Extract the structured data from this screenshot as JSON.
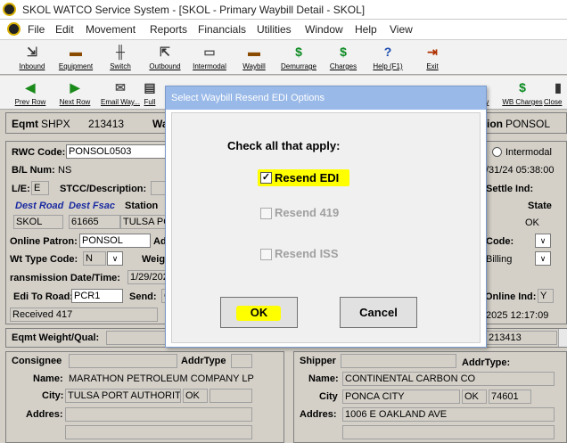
{
  "window": {
    "title": "SKOL WATCO Service System - [SKOL - Primary Waybill Detail - SKOL]"
  },
  "menu": [
    "File",
    "Edit",
    "Movement",
    "Reports",
    "Financials",
    "Utilities",
    "Window",
    "Help",
    "View"
  ],
  "toolbar1": [
    {
      "label": "Inbound",
      "icon": "inbound-icon"
    },
    {
      "label": "Equipment",
      "icon": "equipment-icon"
    },
    {
      "label": "Switch",
      "icon": "switch-icon"
    },
    {
      "label": "Outbound",
      "icon": "outbound-icon"
    },
    {
      "label": "Intermodal",
      "icon": "intermodal-icon"
    },
    {
      "label": "Waybill",
      "icon": "waybill-icon"
    },
    {
      "label": "Demurrage",
      "icon": "demurrage-icon"
    },
    {
      "label": "Charges",
      "icon": "charges-icon"
    },
    {
      "label": "Help (F1)",
      "icon": "help-icon"
    },
    {
      "label": "Exit",
      "icon": "exit-icon"
    }
  ],
  "toolbar2": [
    {
      "label": "Prev Row",
      "icon": "prev-row-icon"
    },
    {
      "label": "Next Row",
      "icon": "next-row-icon"
    },
    {
      "label": "Email Way...",
      "icon": "email-icon"
    },
    {
      "label": "Full",
      "icon": "full-icon"
    },
    {
      "label": "ry",
      "icon": "history-icon"
    },
    {
      "label": "WB Charges",
      "icon": "wb-charges-icon"
    },
    {
      "label": "Close",
      "icon": "close-icon"
    }
  ],
  "header": {
    "eqmt_label": "Eqmt",
    "eqmt_init": "SHPX",
    "eqmt_num": "213413",
    "wa_label": "Wa",
    "station_label": "ion",
    "station_value": "PONSOL"
  },
  "form": {
    "rwc_label": "RWC Code:",
    "rwc_value": "PONSOL0503",
    "bl_label": "B/L Num:",
    "bl_value": "NS",
    "le_label": "L/E:",
    "le_value": "E",
    "stcc_label": "STCC/Description:",
    "dest_road_label": "Dest Road",
    "dest_fsac_label": "Dest Fsac",
    "station_label": "Station",
    "dest_road_value": "SKOL",
    "dest_fsac_value": "61665",
    "station_value": "TULSA PO",
    "online_patron_label": "Online Patron:",
    "online_patron_value": "PONSOL",
    "ad_label": "Ad",
    "wt_type_label": "Wt Type Code:",
    "wt_type_value": "N",
    "weig_label": "Weig",
    "trans_label": "ransmission Date/Time:",
    "trans_value": "1/29/202",
    "edi_road_label": "Edi To Road:",
    "edi_road_value": "PCR1",
    "send_label": "Send:",
    "send_value": "C",
    "received_value": "Received 417",
    "intermodal_label": "Intermodal",
    "date_value": "/31/24 05:38:00",
    "settle_label": "Settle Ind:",
    "state_label": "State",
    "state_value": "OK",
    "code_label": "Code:",
    "billing_value": "Billing",
    "online_ind_label": "Online Ind:",
    "online_ind_value": "Y",
    "time_value": "2025 12:17:09"
  },
  "weight": {
    "label": "Eqmt Weight/Qual:",
    "right_value": "213413"
  },
  "consignee": {
    "title": "Consignee",
    "addrtype_label": "AddrType",
    "name_label": "Name:",
    "name_value": "MARATHON PETROLEUM COMPANY LP",
    "city_label": "City:",
    "city_value": "TULSA PORT AUTHORIT",
    "state_value": "OK",
    "address_label": "Addres:"
  },
  "shipper": {
    "title": "Shipper",
    "addrtype_label": "AddrType:",
    "name_label": "Name:",
    "name_value": "CONTINENTAL CARBON CO",
    "city_label": "City",
    "city_value": "PONCA CITY",
    "state_value": "OK",
    "zip_value": "74601",
    "address_label": "Addres:",
    "address_value": "1006 E OAKLAND AVE"
  },
  "dialog": {
    "title": "Select Waybill Resend EDI Options",
    "prompt": "Check all that apply:",
    "options": [
      {
        "label": "Resend EDI",
        "checked": true,
        "enabled": true
      },
      {
        "label": "Resend 419",
        "checked": false,
        "enabled": false
      },
      {
        "label": "Resend ISS",
        "checked": false,
        "enabled": false
      }
    ],
    "ok_label": "OK",
    "cancel_label": "Cancel",
    "highlight_color": "#ffff00"
  }
}
